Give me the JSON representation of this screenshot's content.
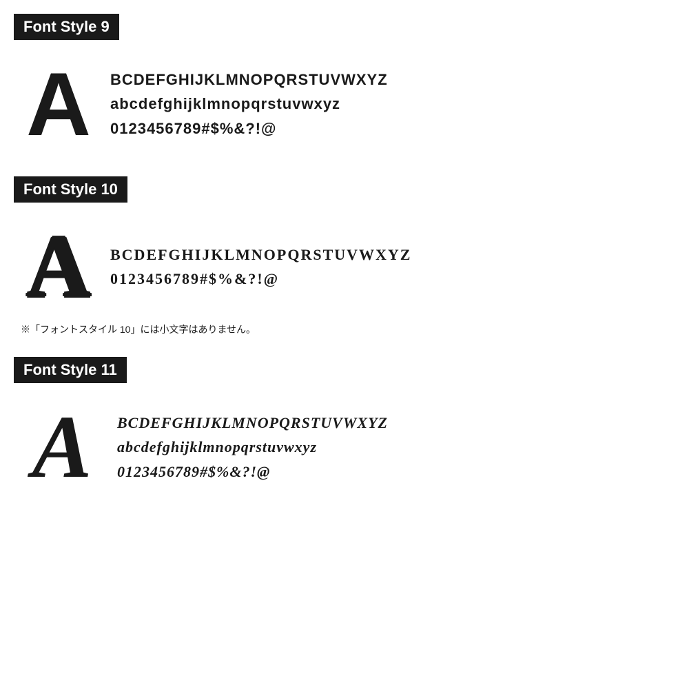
{
  "sections": [
    {
      "id": "font-style-9",
      "title": "Font Style 9",
      "big_letter": "A",
      "lines": [
        "BCDEFGHIJKLMNOPQRSTUVWXYZ",
        "abcdefghijklmnopqrstuvwxyz",
        "0123456789#$%&?!@"
      ],
      "note": null
    },
    {
      "id": "font-style-10",
      "title": "Font Style 10",
      "big_letter": "A",
      "lines": [
        "BCDEFGHIJKLMNOPQRSTUVWXYZ",
        "0123456789#$%&?!@"
      ],
      "note": "※「フォントスタイル 10」には小文字はありません。"
    },
    {
      "id": "font-style-11",
      "title": "Font Style 11",
      "big_letter": "A",
      "lines": [
        "BCDEFGHIJKLMNOPQRSTUVWXYZ",
        "abcdefghijklmnopqrstuvwxyz",
        "0123456789#$%&?!@"
      ],
      "note": null
    }
  ]
}
